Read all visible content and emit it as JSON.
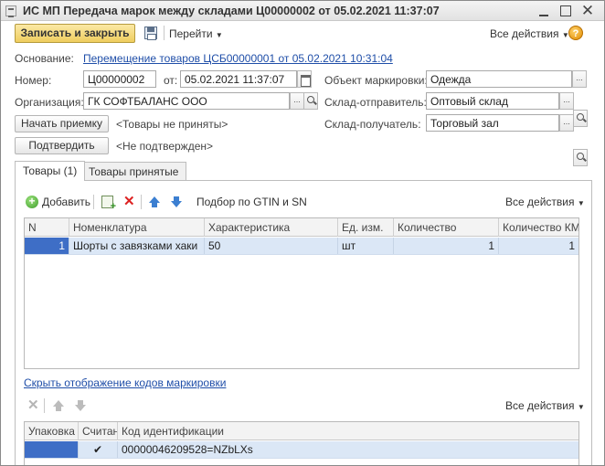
{
  "window": {
    "title": "ИС МП Передача марок между складами Ц00000002 от 05.02.2021 11:37:07",
    "close_glyph": "✕"
  },
  "toolbar": {
    "save_close_label": "Записать и закрыть",
    "goto_label": "Перейти",
    "all_actions_label": "Все действия",
    "help_glyph": "?"
  },
  "form": {
    "basis_label": "Основание:",
    "basis_link": "Перемещение товаров ЦСБ00000001 от 05.02.2021 10:31:04",
    "number_label": "Номер:",
    "number_value": "Ц00000002",
    "date_label": "от:",
    "date_value": "05.02.2021 11:37:07",
    "object_label": "Объект маркировки:",
    "object_value": "Одежда",
    "org_label": "Организация:",
    "org_value": "ГК СОФТБАЛАНС ООО",
    "sender_label": "Склад-отправитель:",
    "sender_value": "Оптовый склад",
    "receiver_label": "Склад-получатель:",
    "receiver_value": "Торговый зал",
    "start_accept_label": "Начать приемку",
    "accept_status": "<Товары не приняты>",
    "confirm_label": "Подтвердить",
    "confirm_status": "<Не подтвержден>"
  },
  "tabs": [
    {
      "label": "Товары (1)",
      "active": true
    },
    {
      "label": "Товары принятые",
      "active": false
    }
  ],
  "goods": {
    "add_label": "Добавить",
    "gtin_label": "Подбор по GTIN и SN",
    "all_actions_label": "Все действия",
    "delete_glyph": "✕",
    "columns": [
      "N",
      "Номенклатура",
      "Характеристика",
      "Ед. изм.",
      "Количество",
      "Количество КМ"
    ],
    "rows": [
      {
        "n": "1",
        "item": "Шорты с завязками хаки",
        "char": "50",
        "unit": "шт",
        "qty": "1",
        "qty_km": "1"
      }
    ]
  },
  "codes": {
    "hide_link": "Скрыть отображение кодов маркировки",
    "all_actions_label": "Все действия",
    "delete_glyph": "✕",
    "columns": [
      "Упаковка",
      "Считан",
      "Код идентификации"
    ],
    "rows": [
      {
        "package": "",
        "scanned": "✔",
        "code": "00000046209528=NZbLXs"
      }
    ]
  }
}
